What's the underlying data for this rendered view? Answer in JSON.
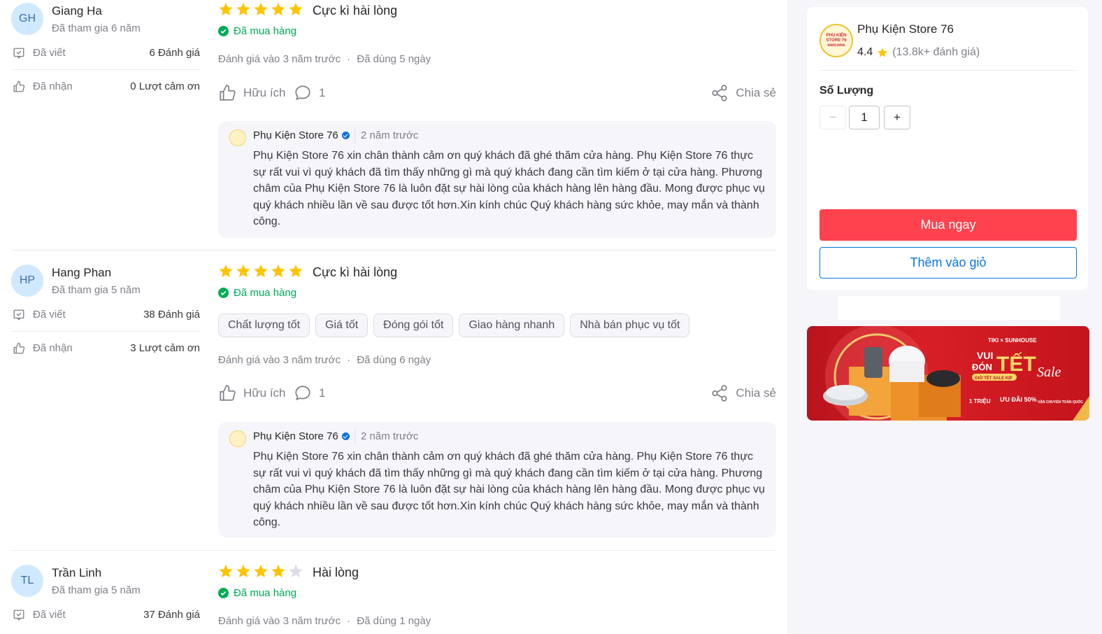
{
  "reviews": [
    {
      "initials": "GH",
      "name": "Giang Ha",
      "joined": "Đã tham gia 6 năm",
      "written_label": "Đã viết",
      "written_value": "6 Đánh giá",
      "received_label": "Đã nhận",
      "received_value": "0 Lượt cảm ơn",
      "rating": 5,
      "title": "Cực kì hài lòng",
      "bought": "Đã mua hàng",
      "chips": [],
      "reviewed": "Đánh giá vào 3 năm trước",
      "dot": "·",
      "used": "Đã dùng 5 ngày",
      "helpful": "Hữu ích",
      "comments": "1",
      "share": "Chia sẻ",
      "reply": {
        "shop": "Phụ Kiện Store 76",
        "time": "2 năm trước",
        "text": "Phụ Kiện Store 76 xin chân thành cảm ơn quý khách đã ghé thăm cửa hàng. Phụ Kiện Store 76 thực sự rất vui vì quý khách đã tìm thấy những gì mà quý khách đang cần tìm kiếm ở tại cửa hàng. Phương châm của Phụ Kiện Store 76 là luôn đặt sự hài lòng của khách hàng lên hàng đầu. Mong được phục vụ quý khách nhiều lần về sau được tốt hơn.Xin kính chúc Quý khách hàng sức khỏe, may mắn và thành công."
      }
    },
    {
      "initials": "HP",
      "name": "Hang Phan",
      "joined": "Đã tham gia 5 năm",
      "written_label": "Đã viết",
      "written_value": "38 Đánh giá",
      "received_label": "Đã nhận",
      "received_value": "3 Lượt cảm ơn",
      "rating": 5,
      "title": "Cực kì hài lòng",
      "bought": "Đã mua hàng",
      "chips": [
        "Chất lượng tốt",
        "Giá tốt",
        "Đóng gói tốt",
        "Giao hàng nhanh",
        "Nhà bán phục vụ tốt"
      ],
      "reviewed": "Đánh giá vào 3 năm trước",
      "dot": "·",
      "used": "Đã dùng 6 ngày",
      "helpful": "Hữu ích",
      "comments": "1",
      "share": "Chia sẻ",
      "reply": {
        "shop": "Phụ Kiện Store 76",
        "time": "2 năm trước",
        "text": "Phụ Kiện Store 76 xin chân thành cảm ơn quý khách đã ghé thăm cửa hàng. Phụ Kiện Store 76 thực sự rất vui vì quý khách đã tìm thấy những gì mà quý khách đang cần tìm kiếm ở tại cửa hàng. Phương châm của Phụ Kiện Store 76 là luôn đặt sự hài lòng của khách hàng lên hàng đầu. Mong được phục vụ quý khách nhiều lần về sau được tốt hơn.Xin kính chúc Quý khách hàng sức khỏe, may mắn và thành công."
      }
    },
    {
      "initials": "TL",
      "name": "Trần Linh",
      "joined": "Đã tham gia 5 năm",
      "written_label": "Đã viết",
      "written_value": "37 Đánh giá",
      "rating": 4,
      "title": "Hài lòng",
      "bought": "Đã mua hàng",
      "chips": [],
      "reviewed": "Đánh giá vào 3 năm trước",
      "dot": "·",
      "used": "Đã dùng 1 ngày"
    }
  ],
  "colors": {
    "star": "#ffc400",
    "star_empty": "#dddde3",
    "verified": "#00ab56",
    "buy": "#ff424e",
    "link": "#0b74e5"
  },
  "store": {
    "logo_text": "PHỤ KIỆN STORE 76 welcome",
    "name": "Phụ Kiện Store 76",
    "rating": "4.4",
    "rating_count": "(13.8k+ đánh giá)",
    "quantity_label": "Số Lượng",
    "quantity_value": "1",
    "minus": "−",
    "plus": "+",
    "buy_now": "Mua ngay",
    "add_to_cart": "Thêm vào giỏ"
  },
  "banner": {
    "brand": "TIKI × SUNHOUSE",
    "line1": "VUI",
    "line2": "ĐÓN",
    "tet": "TẾT",
    "sale": "Sale",
    "sub": "GIỜ TẾT SALE KỊP",
    "offer1": "1 TRIỆU",
    "offer2": "ƯU ĐÃI 50%",
    "offer3": "VẬN CHUYỂN TOÀN QUỐC"
  }
}
